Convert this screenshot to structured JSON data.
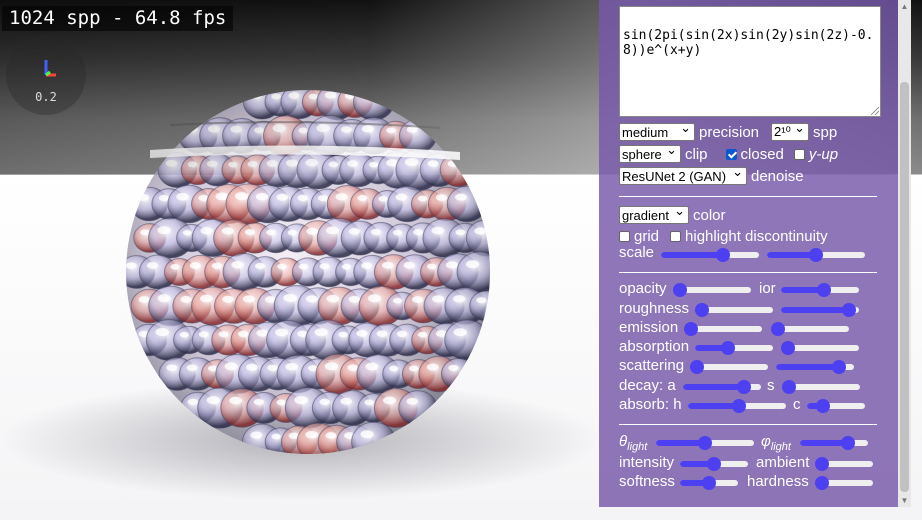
{
  "overlay": {
    "fps_text": "1024 spp - 64.8 fps",
    "zoom": "0.2",
    "axis_colors": {
      "x": "#ff4040",
      "y": "#40ff40",
      "z": "#4060ff"
    }
  },
  "editor": {
    "equation_text": "sin(2pi(sin(2x)sin(2y)sin(2z)-0.8))e^(x+y)"
  },
  "render_settings": {
    "precision_value": "medium",
    "precision_label": "precision",
    "spp_value": "2¹⁰",
    "spp_label": "spp",
    "clip_value": "sphere",
    "clip_label": "clip",
    "closed_label": "closed",
    "closed_checked": true,
    "yup_label": "y-up",
    "yup_checked": false,
    "denoise_value": "ResUNet 2 (GAN)",
    "denoise_label": "denoise"
  },
  "color_settings": {
    "color_value": "gradient",
    "color_label": "color",
    "grid_label": "grid",
    "grid_checked": false,
    "highlight_label": "highlight discontinuity",
    "highlight_checked": false,
    "scale_label": "scale",
    "scale_left": 0.66,
    "scale_right": 0.5
  },
  "material": {
    "opacity_label": "opacity",
    "opacity": 0.0,
    "ior_label": "ior",
    "ior": 0.57,
    "roughness_label": "roughness",
    "roughness": 0.0,
    "roughness_right": 0.95,
    "emission_label": "emission",
    "emission": 0.0,
    "emission_right": 0.0,
    "absorption_label": "absorption",
    "absorption": 0.4,
    "absorption_right": 0.0,
    "scattering_label": "scattering",
    "scattering": 0.0,
    "scattering_right": 0.88,
    "decay_a_label": "decay: a",
    "decay_a": 0.84,
    "decay_s_label": "s",
    "decay_s": 0.0,
    "absorb_h_label": "absorb: h",
    "absorb_h": 0.52,
    "absorb_c_label": "c",
    "absorb_c": 0.2
  },
  "lighting": {
    "theta_symbol": "θ",
    "theta_sub": "light",
    "theta": 0.5,
    "phi_symbol": "φ",
    "phi_sub": "light",
    "phi": 0.75,
    "intensity_label": "intensity",
    "intensity": 0.5,
    "ambient_label": "ambient",
    "ambient": 0.0,
    "softness_label": "softness",
    "softness": 0.5,
    "hardness_label": "hardness",
    "hardness": 0.0
  }
}
